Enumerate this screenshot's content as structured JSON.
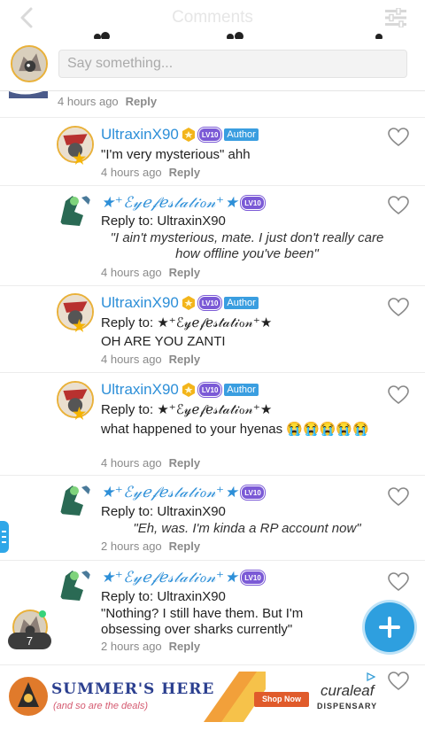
{
  "header": {
    "title": "Comments"
  },
  "composer": {
    "placeholder": "Say something..."
  },
  "top_partial": {
    "time": "4 hours ago",
    "reply": "Reply"
  },
  "comments": [
    {
      "name": "UltraxinX90",
      "level": "LV10",
      "author_badge": "Author",
      "text": "\"I'm very mysterious\" ahh",
      "time": "4 hours ago",
      "reply": "Reply"
    },
    {
      "name": "★⁺ℰ𝓎ℯ𝒻ℯ𝓈𝓉𝒶𝓉𝒾ℴ𝓃⁺★",
      "level": "LV10",
      "reply_to": "Reply to: UltraxinX90",
      "text": "\"I ain't mysterious, mate. I just don't really care how offline you've been\"",
      "time": "4 hours ago",
      "reply": "Reply"
    },
    {
      "name": "UltraxinX90",
      "level": "LV10",
      "author_badge": "Author",
      "reply_to": "Reply to: ★⁺ℰ𝓎ℯ𝒻ℯ𝓈𝓉𝒶𝓉𝒾ℴ𝓃⁺★",
      "text": "OH ARE YOU ZANTI",
      "time": "4 hours ago",
      "reply": "Reply"
    },
    {
      "name": "UltraxinX90",
      "level": "LV10",
      "author_badge": "Author",
      "reply_to": "Reply to: ★⁺ℰ𝓎ℯ𝒻ℯ𝓈𝓉𝒶𝓉𝒾ℴ𝓃⁺★",
      "text": "what happened to your hyenas 😭😭😭😭😭",
      "time": "4 hours ago",
      "reply": "Reply"
    },
    {
      "name": "★⁺ℰ𝓎ℯ𝒻ℯ𝓈𝓉𝒶𝓉𝒾ℴ𝓃⁺★",
      "level": "LV10",
      "reply_to": "Reply to: UltraxinX90",
      "text": "\"Eh, was. I'm kinda a RP account now\"",
      "time": "2 hours ago",
      "reply": "Reply"
    },
    {
      "name": "★⁺ℰ𝓎ℯ𝒻ℯ𝓈𝓉𝒶𝓉𝒾ℴ𝓃⁺★",
      "level": "LV10",
      "reply_to": "Reply to: UltraxinX90",
      "text": "\"Nothing? I still have them. But I'm obsessing over sharks currently\"",
      "time": "2 hours ago",
      "reply": "Reply"
    }
  ],
  "floating": {
    "unread_count": "7"
  },
  "ad": {
    "headline": "SUMMER'S HERE",
    "sub": "(and so are the deals)",
    "cta": "Shop Now",
    "brand": "curaleaf",
    "brand_sub": "DISPENSARY"
  },
  "colors": {
    "accent": "#2e9fdf",
    "name": "#2d8fd8",
    "author": "#3a9ee0",
    "level": "#7b5ad6",
    "gold": "#e9b13a"
  }
}
